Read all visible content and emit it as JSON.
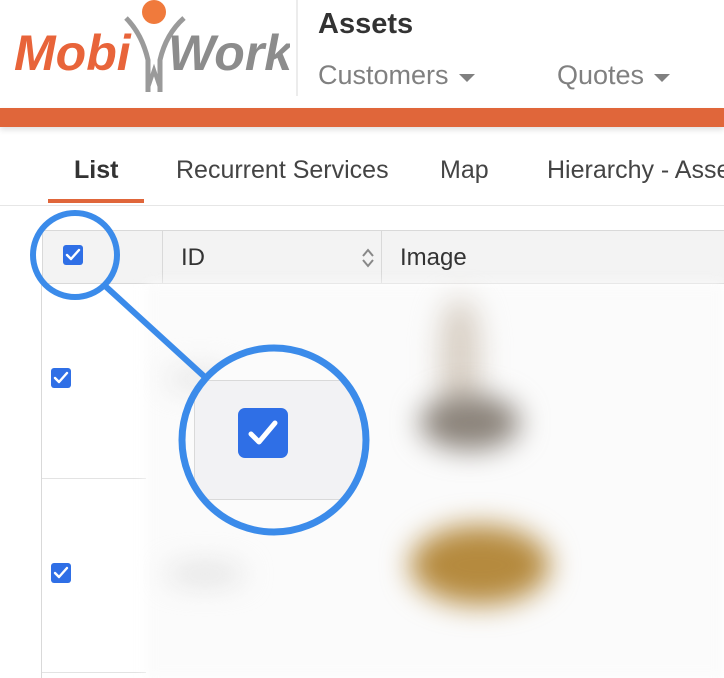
{
  "app": {
    "logo_text_left": "Mobi",
    "logo_text_right": "Work",
    "section_title": "Assets"
  },
  "top_nav": [
    {
      "label": "Customers"
    },
    {
      "label": "Quotes"
    }
  ],
  "tabs": [
    {
      "label": "List",
      "active": true
    },
    {
      "label": "Recurrent Services",
      "active": false
    },
    {
      "label": "Map",
      "active": false
    },
    {
      "label": "Hierarchy - Asse",
      "active": false
    }
  ],
  "table": {
    "columns": [
      {
        "label": ""
      },
      {
        "label": "ID"
      },
      {
        "label": "Image"
      }
    ],
    "select_all_checked": true,
    "rows": [
      {
        "selected": true
      },
      {
        "selected": true
      }
    ]
  },
  "colors": {
    "accent": "#e0663a",
    "checkbox": "#2f6fe6",
    "annotation": "#3b8bea"
  }
}
